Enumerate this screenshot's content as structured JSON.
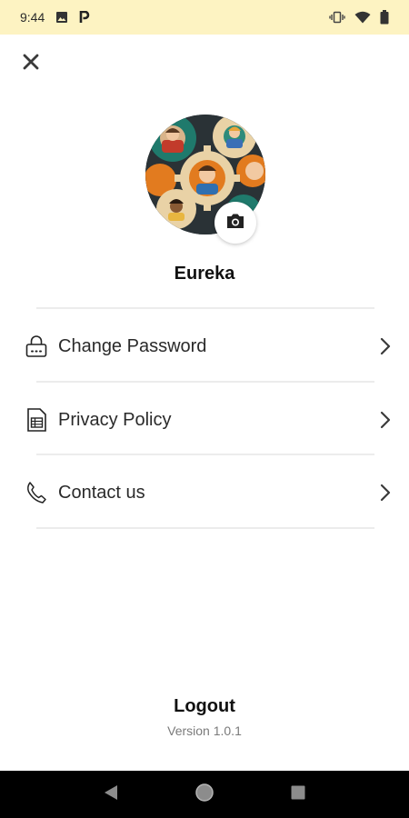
{
  "status_bar": {
    "time": "9:44",
    "left_icons": [
      "image-icon",
      "parking-icon"
    ],
    "right_icons": [
      "vibrate-icon",
      "wifi-icon",
      "battery-icon"
    ],
    "background": "#fdf3c2"
  },
  "header": {
    "close_icon": "close-icon"
  },
  "profile": {
    "name": "Eureka",
    "camera_icon": "camera-icon"
  },
  "menu": {
    "items": [
      {
        "label": "Change Password",
        "icon": "lock-icon"
      },
      {
        "label": "Privacy Policy",
        "icon": "document-icon"
      },
      {
        "label": "Contact us",
        "icon": "phone-icon"
      }
    ]
  },
  "footer": {
    "logout_label": "Logout",
    "version": "Version 1.0.1"
  },
  "nav_bar": {
    "buttons": [
      "back-icon",
      "home-icon",
      "recents-icon"
    ]
  }
}
